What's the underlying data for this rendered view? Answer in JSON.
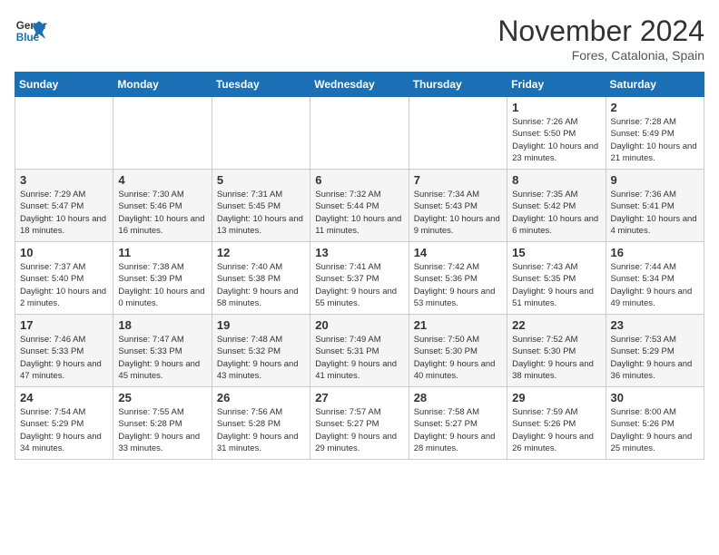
{
  "logo": {
    "line1": "General",
    "line2": "Blue"
  },
  "header": {
    "month": "November 2024",
    "location": "Fores, Catalonia, Spain"
  },
  "days_of_week": [
    "Sunday",
    "Monday",
    "Tuesday",
    "Wednesday",
    "Thursday",
    "Friday",
    "Saturday"
  ],
  "weeks": [
    [
      {
        "day": "",
        "info": ""
      },
      {
        "day": "",
        "info": ""
      },
      {
        "day": "",
        "info": ""
      },
      {
        "day": "",
        "info": ""
      },
      {
        "day": "",
        "info": ""
      },
      {
        "day": "1",
        "info": "Sunrise: 7:26 AM\nSunset: 5:50 PM\nDaylight: 10 hours and 23 minutes."
      },
      {
        "day": "2",
        "info": "Sunrise: 7:28 AM\nSunset: 5:49 PM\nDaylight: 10 hours and 21 minutes."
      }
    ],
    [
      {
        "day": "3",
        "info": "Sunrise: 7:29 AM\nSunset: 5:47 PM\nDaylight: 10 hours and 18 minutes."
      },
      {
        "day": "4",
        "info": "Sunrise: 7:30 AM\nSunset: 5:46 PM\nDaylight: 10 hours and 16 minutes."
      },
      {
        "day": "5",
        "info": "Sunrise: 7:31 AM\nSunset: 5:45 PM\nDaylight: 10 hours and 13 minutes."
      },
      {
        "day": "6",
        "info": "Sunrise: 7:32 AM\nSunset: 5:44 PM\nDaylight: 10 hours and 11 minutes."
      },
      {
        "day": "7",
        "info": "Sunrise: 7:34 AM\nSunset: 5:43 PM\nDaylight: 10 hours and 9 minutes."
      },
      {
        "day": "8",
        "info": "Sunrise: 7:35 AM\nSunset: 5:42 PM\nDaylight: 10 hours and 6 minutes."
      },
      {
        "day": "9",
        "info": "Sunrise: 7:36 AM\nSunset: 5:41 PM\nDaylight: 10 hours and 4 minutes."
      }
    ],
    [
      {
        "day": "10",
        "info": "Sunrise: 7:37 AM\nSunset: 5:40 PM\nDaylight: 10 hours and 2 minutes."
      },
      {
        "day": "11",
        "info": "Sunrise: 7:38 AM\nSunset: 5:39 PM\nDaylight: 10 hours and 0 minutes."
      },
      {
        "day": "12",
        "info": "Sunrise: 7:40 AM\nSunset: 5:38 PM\nDaylight: 9 hours and 58 minutes."
      },
      {
        "day": "13",
        "info": "Sunrise: 7:41 AM\nSunset: 5:37 PM\nDaylight: 9 hours and 55 minutes."
      },
      {
        "day": "14",
        "info": "Sunrise: 7:42 AM\nSunset: 5:36 PM\nDaylight: 9 hours and 53 minutes."
      },
      {
        "day": "15",
        "info": "Sunrise: 7:43 AM\nSunset: 5:35 PM\nDaylight: 9 hours and 51 minutes."
      },
      {
        "day": "16",
        "info": "Sunrise: 7:44 AM\nSunset: 5:34 PM\nDaylight: 9 hours and 49 minutes."
      }
    ],
    [
      {
        "day": "17",
        "info": "Sunrise: 7:46 AM\nSunset: 5:33 PM\nDaylight: 9 hours and 47 minutes."
      },
      {
        "day": "18",
        "info": "Sunrise: 7:47 AM\nSunset: 5:33 PM\nDaylight: 9 hours and 45 minutes."
      },
      {
        "day": "19",
        "info": "Sunrise: 7:48 AM\nSunset: 5:32 PM\nDaylight: 9 hours and 43 minutes."
      },
      {
        "day": "20",
        "info": "Sunrise: 7:49 AM\nSunset: 5:31 PM\nDaylight: 9 hours and 41 minutes."
      },
      {
        "day": "21",
        "info": "Sunrise: 7:50 AM\nSunset: 5:30 PM\nDaylight: 9 hours and 40 minutes."
      },
      {
        "day": "22",
        "info": "Sunrise: 7:52 AM\nSunset: 5:30 PM\nDaylight: 9 hours and 38 minutes."
      },
      {
        "day": "23",
        "info": "Sunrise: 7:53 AM\nSunset: 5:29 PM\nDaylight: 9 hours and 36 minutes."
      }
    ],
    [
      {
        "day": "24",
        "info": "Sunrise: 7:54 AM\nSunset: 5:29 PM\nDaylight: 9 hours and 34 minutes."
      },
      {
        "day": "25",
        "info": "Sunrise: 7:55 AM\nSunset: 5:28 PM\nDaylight: 9 hours and 33 minutes."
      },
      {
        "day": "26",
        "info": "Sunrise: 7:56 AM\nSunset: 5:28 PM\nDaylight: 9 hours and 31 minutes."
      },
      {
        "day": "27",
        "info": "Sunrise: 7:57 AM\nSunset: 5:27 PM\nDaylight: 9 hours and 29 minutes."
      },
      {
        "day": "28",
        "info": "Sunrise: 7:58 AM\nSunset: 5:27 PM\nDaylight: 9 hours and 28 minutes."
      },
      {
        "day": "29",
        "info": "Sunrise: 7:59 AM\nSunset: 5:26 PM\nDaylight: 9 hours and 26 minutes."
      },
      {
        "day": "30",
        "info": "Sunrise: 8:00 AM\nSunset: 5:26 PM\nDaylight: 9 hours and 25 minutes."
      }
    ]
  ]
}
